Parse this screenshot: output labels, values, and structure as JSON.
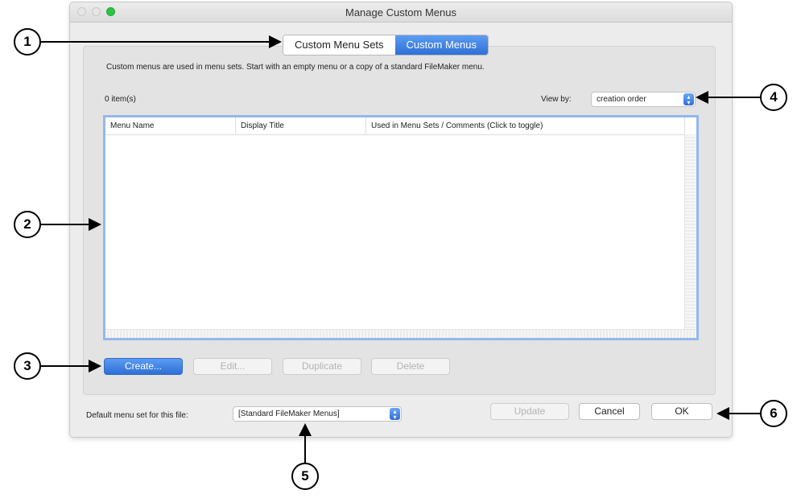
{
  "window": {
    "title": "Manage Custom Menus"
  },
  "tabs": [
    {
      "label": "Custom Menu Sets",
      "active": false
    },
    {
      "label": "Custom Menus",
      "active": true
    }
  ],
  "description": "Custom menus are used in menu sets. Start with an empty menu or a copy of a standard FileMaker menu.",
  "item_count": "0 item(s)",
  "view_by": {
    "label": "View by:",
    "value": "creation order"
  },
  "table": {
    "columns": [
      "Menu Name",
      "Display Title",
      "Used in Menu Sets / Comments (Click to toggle)"
    ],
    "rows": []
  },
  "actions": {
    "create": "Create...",
    "edit": "Edit...",
    "duplicate": "Duplicate",
    "delete": "Delete"
  },
  "default_menu_set": {
    "label": "Default menu set for this file:",
    "value": "[Standard FileMaker Menus]"
  },
  "footer_buttons": {
    "update": "Update",
    "cancel": "Cancel",
    "ok": "OK"
  },
  "annotations": [
    "1",
    "2",
    "3",
    "4",
    "5",
    "6"
  ],
  "colors": {
    "accent": "#2f6fd6",
    "table_focus_border": "#93b8ec",
    "window_bg": "#ececec"
  }
}
